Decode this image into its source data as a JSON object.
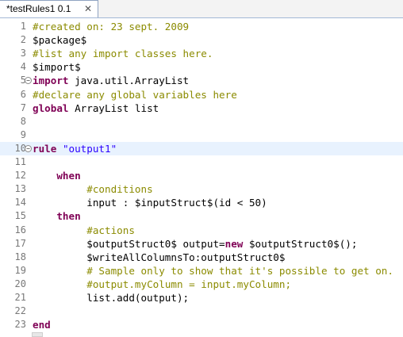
{
  "tab": {
    "title": "*testRules1 0.1",
    "close_glyph": "✕"
  },
  "lines": [
    {
      "n": "1",
      "tokens": [
        {
          "t": "#created on: 23 sept. 2009",
          "c": "cm"
        }
      ]
    },
    {
      "n": "2",
      "tokens": [
        {
          "t": "$package$",
          "c": ""
        }
      ]
    },
    {
      "n": "3",
      "tokens": [
        {
          "t": "#list any import classes here.",
          "c": "cm"
        }
      ]
    },
    {
      "n": "4",
      "tokens": [
        {
          "t": "$import$",
          "c": ""
        }
      ]
    },
    {
      "n": "5",
      "fold": true,
      "tokens": [
        {
          "t": "import",
          "c": "kw"
        },
        {
          "t": " java.util.ArrayList",
          "c": ""
        }
      ]
    },
    {
      "n": "6",
      "tokens": [
        {
          "t": "#declare any global variables here",
          "c": "cm"
        }
      ]
    },
    {
      "n": "7",
      "tokens": [
        {
          "t": "global",
          "c": "kw"
        },
        {
          "t": " ArrayList list",
          "c": ""
        }
      ]
    },
    {
      "n": "8",
      "tokens": []
    },
    {
      "n": "9",
      "tokens": []
    },
    {
      "n": "10",
      "fold": true,
      "current": true,
      "tokens": [
        {
          "t": "rule",
          "c": "kw"
        },
        {
          "t": " ",
          "c": ""
        },
        {
          "t": "\"output1\"",
          "c": "st"
        }
      ]
    },
    {
      "n": "11",
      "tokens": []
    },
    {
      "n": "12",
      "tokens": [
        {
          "t": "    ",
          "c": ""
        },
        {
          "t": "when",
          "c": "kw"
        }
      ]
    },
    {
      "n": "13",
      "tokens": [
        {
          "t": "         ",
          "c": ""
        },
        {
          "t": "#conditions",
          "c": "cm"
        }
      ]
    },
    {
      "n": "14",
      "tokens": [
        {
          "t": "         input : $inputStruct$(id < 50)",
          "c": ""
        }
      ]
    },
    {
      "n": "15",
      "tokens": [
        {
          "t": "    ",
          "c": ""
        },
        {
          "t": "then",
          "c": "kw"
        }
      ]
    },
    {
      "n": "16",
      "tokens": [
        {
          "t": "         ",
          "c": ""
        },
        {
          "t": "#actions",
          "c": "cm"
        }
      ]
    },
    {
      "n": "17",
      "tokens": [
        {
          "t": "         $outputStruct0$ output=",
          "c": ""
        },
        {
          "t": "new",
          "c": "kw"
        },
        {
          "t": " $outputStruct0$();",
          "c": ""
        }
      ]
    },
    {
      "n": "18",
      "tokens": [
        {
          "t": "         $writeAllColumnsTo:outputStruct0$",
          "c": ""
        }
      ]
    },
    {
      "n": "19",
      "tokens": [
        {
          "t": "         ",
          "c": ""
        },
        {
          "t": "# Sample only to show that it's possible to get on.",
          "c": "cm"
        }
      ]
    },
    {
      "n": "20",
      "tokens": [
        {
          "t": "         ",
          "c": ""
        },
        {
          "t": "#output.myColumn = input.myColumn;",
          "c": "cm"
        }
      ]
    },
    {
      "n": "21",
      "tokens": [
        {
          "t": "         list.add(output);",
          "c": ""
        }
      ]
    },
    {
      "n": "22",
      "tokens": []
    },
    {
      "n": "23",
      "tokens": [
        {
          "t": "end",
          "c": "kw"
        }
      ]
    }
  ]
}
